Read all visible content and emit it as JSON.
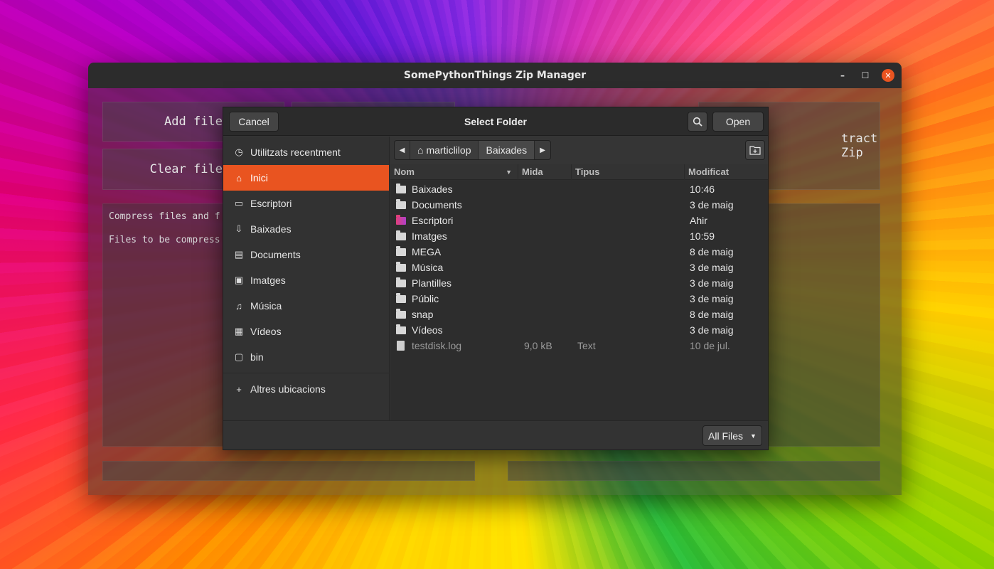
{
  "window": {
    "title": "SomePythonThings Zip Manager",
    "controls": {
      "minimize": "–",
      "maximize": "☐",
      "close": "✕"
    }
  },
  "app": {
    "add_files": "Add file",
    "clear_list": "Clear file l",
    "extract_zip": "tract Zip",
    "compress_text": "Compress files and f",
    "files_text": "Files to be compress"
  },
  "dialog": {
    "title": "Select Folder",
    "cancel": "Cancel",
    "open": "Open",
    "filter": "All Files",
    "sidebar": [
      {
        "label": "Utilitzats recentment",
        "icon": "recent-icon",
        "glyph": "◷"
      },
      {
        "label": "Inici",
        "icon": "home-icon",
        "glyph": "⌂",
        "active": true
      },
      {
        "label": "Escriptori",
        "icon": "desktop-icon",
        "glyph": "▭"
      },
      {
        "label": "Baixades",
        "icon": "download-icon",
        "glyph": "⇩"
      },
      {
        "label": "Documents",
        "icon": "document-icon",
        "glyph": "▤"
      },
      {
        "label": "Imatges",
        "icon": "image-icon",
        "glyph": "▣"
      },
      {
        "label": "Música",
        "icon": "music-icon",
        "glyph": "♫"
      },
      {
        "label": "Vídeos",
        "icon": "video-icon",
        "glyph": "▦"
      },
      {
        "label": "bin",
        "icon": "folder-icon",
        "glyph": "▢"
      }
    ],
    "other_locations": {
      "label": "Altres ubicacions",
      "glyph": "+"
    },
    "path": {
      "home": "marticlilop",
      "current": "Baixades"
    },
    "columns": {
      "name": "Nom",
      "size": "Mida",
      "type": "Tipus",
      "modified": "Modificat"
    },
    "files": [
      {
        "name": "Baixades",
        "size": "",
        "type": "",
        "modified": "10:46",
        "kind": "folder"
      },
      {
        "name": "Documents",
        "size": "",
        "type": "",
        "modified": "3 de maig",
        "kind": "folder"
      },
      {
        "name": "Escriptori",
        "size": "",
        "type": "",
        "modified": "Ahir",
        "kind": "desktop"
      },
      {
        "name": "Imatges",
        "size": "",
        "type": "",
        "modified": "10:59",
        "kind": "folder"
      },
      {
        "name": "MEGA",
        "size": "",
        "type": "",
        "modified": "8 de maig",
        "kind": "folder"
      },
      {
        "name": "Música",
        "size": "",
        "type": "",
        "modified": "3 de maig",
        "kind": "folder"
      },
      {
        "name": "Plantilles",
        "size": "",
        "type": "",
        "modified": "3 de maig",
        "kind": "folder"
      },
      {
        "name": "Públic",
        "size": "",
        "type": "",
        "modified": "3 de maig",
        "kind": "folder"
      },
      {
        "name": "snap",
        "size": "",
        "type": "",
        "modified": "8 de maig",
        "kind": "folder"
      },
      {
        "name": "Vídeos",
        "size": "",
        "type": "",
        "modified": "3 de maig",
        "kind": "folder"
      },
      {
        "name": "testdisk.log",
        "size": "9,0 kB",
        "type": "Text",
        "modified": "10 de jul.",
        "kind": "file"
      }
    ]
  }
}
